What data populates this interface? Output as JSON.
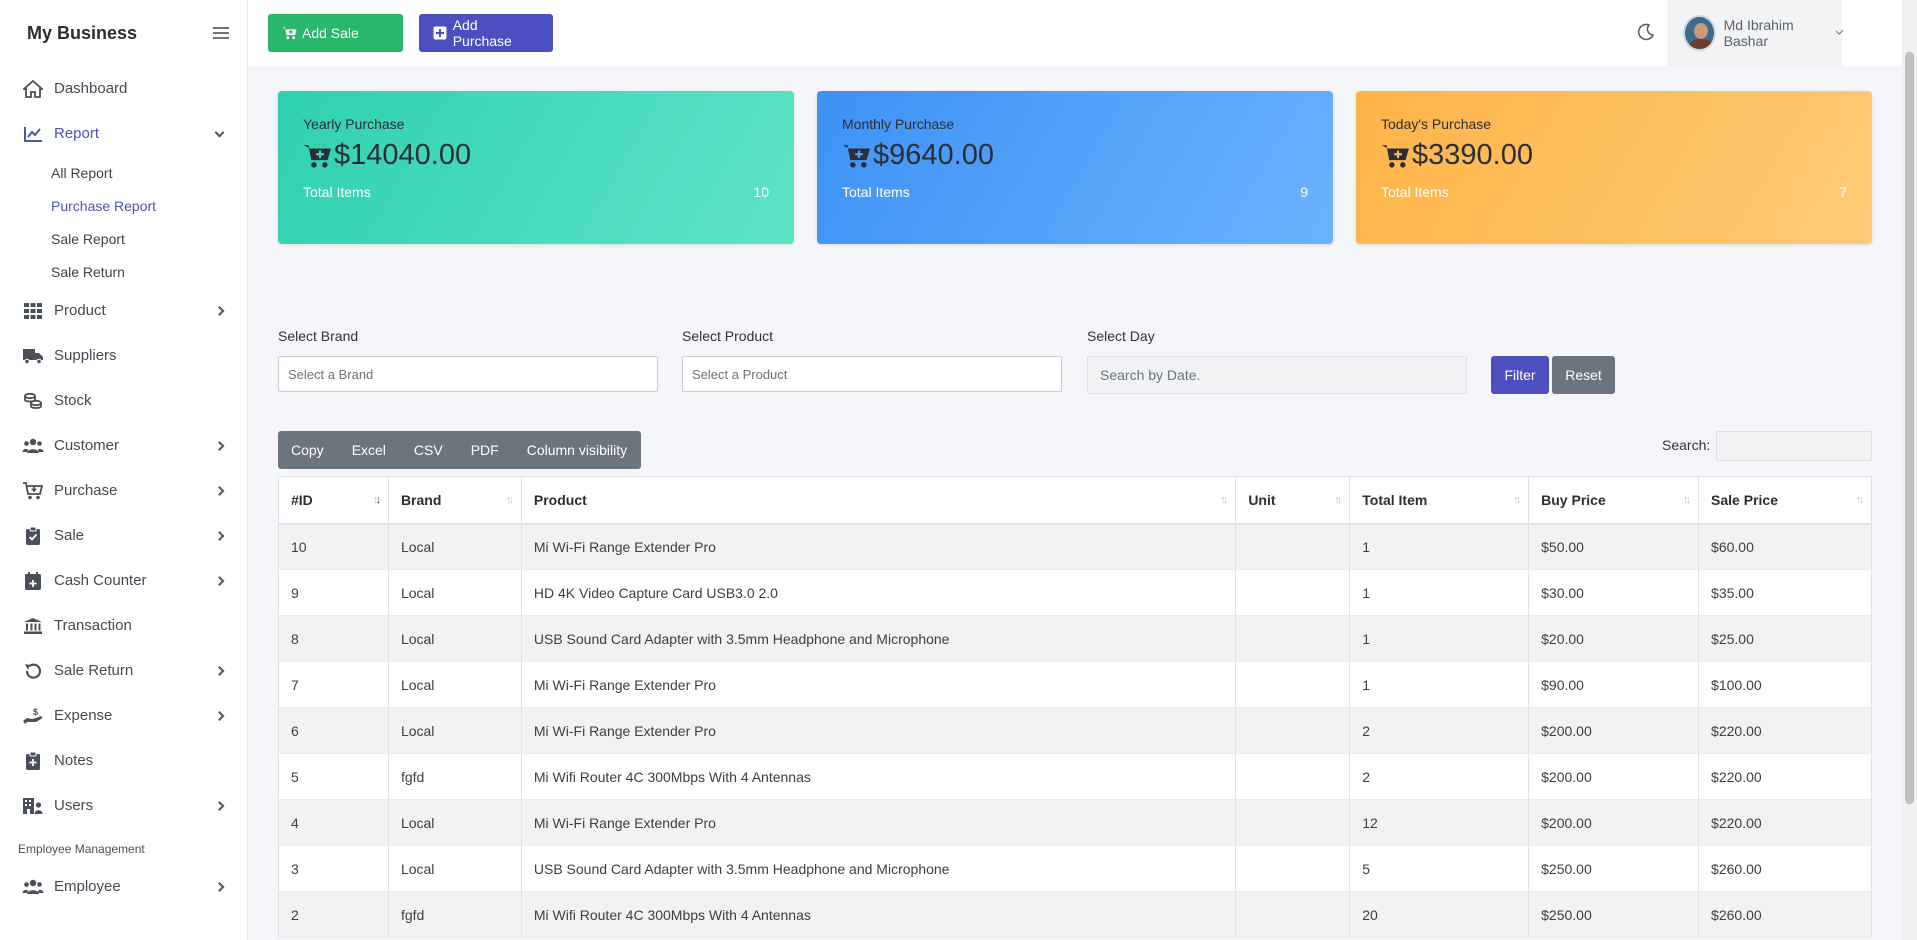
{
  "sidebar": {
    "brand": "My Business",
    "items": [
      {
        "label": "Dashboard"
      },
      {
        "label": "Report"
      },
      {
        "label": "Product"
      },
      {
        "label": "Suppliers"
      },
      {
        "label": "Stock"
      },
      {
        "label": "Customer"
      },
      {
        "label": "Purchase"
      },
      {
        "label": "Sale"
      },
      {
        "label": "Cash Counter"
      },
      {
        "label": "Transaction"
      },
      {
        "label": "Sale Return"
      },
      {
        "label": "Expense"
      },
      {
        "label": "Notes"
      },
      {
        "label": "Users"
      },
      {
        "label": "Employee"
      }
    ],
    "report_sub": [
      "All Report",
      "Purchase Report",
      "Sale Report",
      "Sale Return"
    ],
    "section": "Employee Management"
  },
  "topbar": {
    "add_sale": "Add Sale",
    "add_purchase": "Add Purchase",
    "user_name": "Md Ibrahim Bashar"
  },
  "cards": {
    "yearly": {
      "title": "Yearly Purchase",
      "amount": "$14040.00",
      "label": "Total Items",
      "count": "10"
    },
    "monthly": {
      "title": "Monthly Purchase",
      "amount": "$9640.00",
      "label": "Total Items",
      "count": "9"
    },
    "today": {
      "title": "Today's Purchase",
      "amount": "$3390.00",
      "label": "Total Items",
      "count": "7"
    }
  },
  "filters": {
    "brand_label": "Select Brand",
    "brand_placeholder": "Select a Brand",
    "product_label": "Select Product",
    "product_placeholder": "Select a Product",
    "day_label": "Select Day",
    "day_placeholder": "Search by Date.",
    "filter": "Filter",
    "reset": "Reset"
  },
  "export": [
    "Copy",
    "Excel",
    "CSV",
    "PDF",
    "Column visibility"
  ],
  "search_label": "Search:",
  "table": {
    "columns": [
      "#ID",
      "Brand",
      "Product",
      "Unit",
      "Total Item",
      "Buy Price",
      "Sale Price"
    ],
    "rows": [
      [
        "10",
        "Local",
        "Mi Wi-Fi Range Extender Pro",
        "",
        "1",
        "$50.00",
        "$60.00"
      ],
      [
        "9",
        "Local",
        "HD 4K Video Capture Card USB3.0 2.0",
        "",
        "1",
        "$30.00",
        "$35.00"
      ],
      [
        "8",
        "Local",
        "USB Sound Card Adapter with 3.5mm Headphone and Microphone",
        "",
        "1",
        "$20.00",
        "$25.00"
      ],
      [
        "7",
        "Local",
        "Mi Wi-Fi Range Extender Pro",
        "",
        "1",
        "$90.00",
        "$100.00"
      ],
      [
        "6",
        "Local",
        "Mi Wi-Fi Range Extender Pro",
        "",
        "2",
        "$200.00",
        "$220.00"
      ],
      [
        "5",
        "fgfd",
        "Mi Wifi Router 4C 300Mbps With 4 Antennas",
        "",
        "2",
        "$200.00",
        "$220.00"
      ],
      [
        "4",
        "Local",
        "Mi Wi-Fi Range Extender Pro",
        "",
        "12",
        "$200.00",
        "$220.00"
      ],
      [
        "3",
        "Local",
        "USB Sound Card Adapter with 3.5mm Headphone and Microphone",
        "",
        "5",
        "$250.00",
        "$260.00"
      ],
      [
        "2",
        "fgfd",
        "Mi Wifi Router 4C 300Mbps With 4 Antennas",
        "",
        "20",
        "$250.00",
        "$260.00"
      ]
    ]
  },
  "icons": {
    "dashboard": "house-icon",
    "report": "chart-line-icon",
    "product": "grid-icon",
    "suppliers": "truck-icon",
    "stock": "boxes-icon",
    "customer": "users-icon",
    "purchase": "cart-plus-icon",
    "sale": "clipboard-check-icon",
    "cash": "calendar-plus-icon",
    "transaction": "bank-icon",
    "sale_return": "undo-icon",
    "expense": "hand-dollar-icon",
    "notes": "clipboard-plus-icon",
    "users": "building-user-icon",
    "employee": "users-icon"
  },
  "colors": {
    "accent": "#4b4fc0",
    "success": "#28b76b",
    "teal": "#2fd1b0",
    "blue": "#3d92f5",
    "orange": "#ffb347",
    "gray": "#6c757d"
  }
}
